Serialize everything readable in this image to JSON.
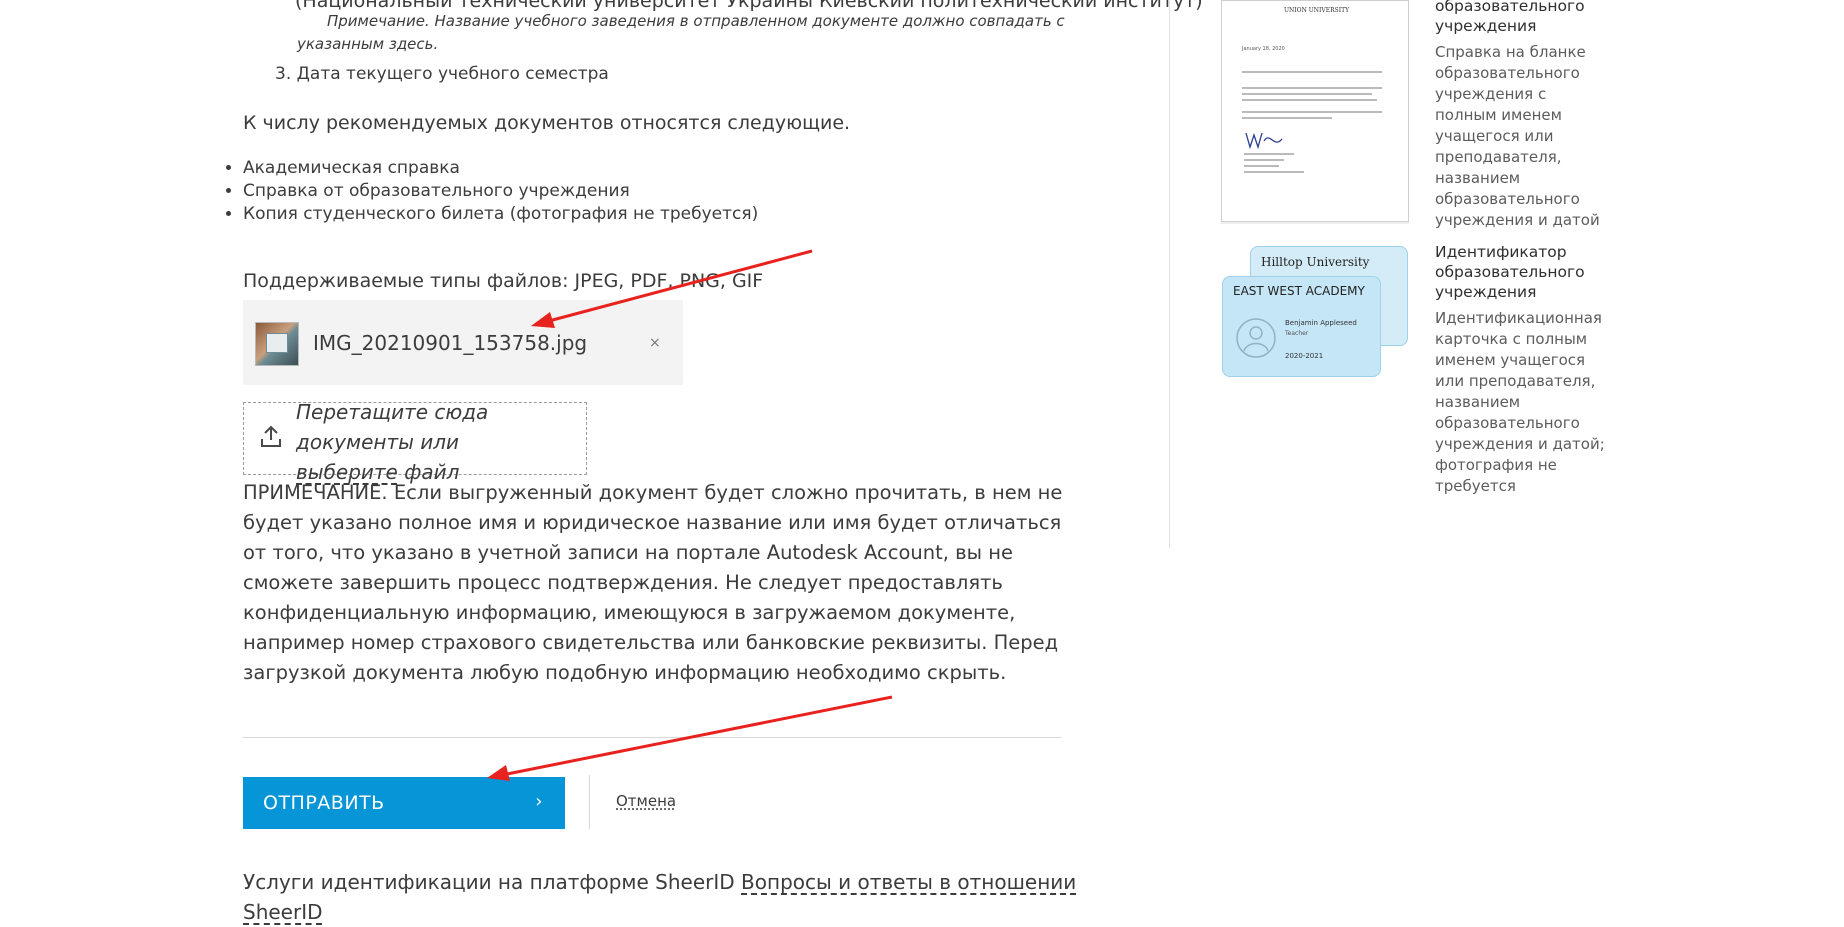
{
  "list": {
    "partial_line": "(Национальный технический университет Украины Киевский политехнический институт)",
    "note_line1": "Примечание. Название учебного заведения в отправленном документе должно совпадать с",
    "note_line2": "указанным здесь.",
    "item3": "3. Дата текущего учебного семестра"
  },
  "recommended": {
    "intro": "К числу рекомендуемых документов относятся следующие.",
    "items": [
      "Академическая справка",
      "Справка от образовательного учреждения",
      "Копия студенческого билета (фотография не требуется)"
    ]
  },
  "upload": {
    "supported_types": "Поддерживаемые типы файлов: JPEG, PDF, PNG, GIF",
    "file_name": "IMG_20210901_153758.jpg",
    "remove": "×",
    "drop_text": "Перетащите сюда документы или ",
    "drop_link": "выберите",
    "drop_tail": " файл"
  },
  "warning": "ПРИМЕЧАНИЕ. Если выгруженный документ будет сложно прочитать, в нем не будет указано полное имя и юридическое название или имя будет отличаться от того, что указано в учетной записи на портале Autodesk Account, вы не сможете завершить процесс подтверждения. Не следует предоставлять конфиденциальную информацию, имеющуюся в загружаемом документе, например номер страхового свидетельства или банковские реквизиты. Перед загрузкой документа любую подобную информацию необходимо скрыть.",
  "actions": {
    "submit": "ОТПРАВИТЬ",
    "submit_icon": "chevron-right-icon",
    "cancel": "Отмена"
  },
  "footer": {
    "text": "Услуги идентификации на платформе SheerID ",
    "link": "Вопросы и ответы в отношении SheerID"
  },
  "sidebar": {
    "letter": {
      "title_tail": "образовательного учреждения",
      "desc": "Справка на бланке образовательного учреждения с полным именем учащегося или преподавателя, названием образовательного учреждения и датой",
      "doc_university": "UNION UNIVERSITY",
      "doc_date": "January 18, 2020"
    },
    "id_card": {
      "title": "Идентификатор образовательного учреждения",
      "desc": "Идентификационная карточка с полным именем учащегося или преподавателя, названием образовательного учреждения и датой; фотография не требуется",
      "card_back": "Hilltop University",
      "card_front": "EAST WEST ACADEMY",
      "card_name": "Benjamin Appleseed",
      "card_role": "Teacher",
      "card_year": "2020-2021"
    }
  },
  "colors": {
    "primary": "#0696d7",
    "text": "#3c3c3c",
    "annotation_arrow": "#e8221e"
  }
}
